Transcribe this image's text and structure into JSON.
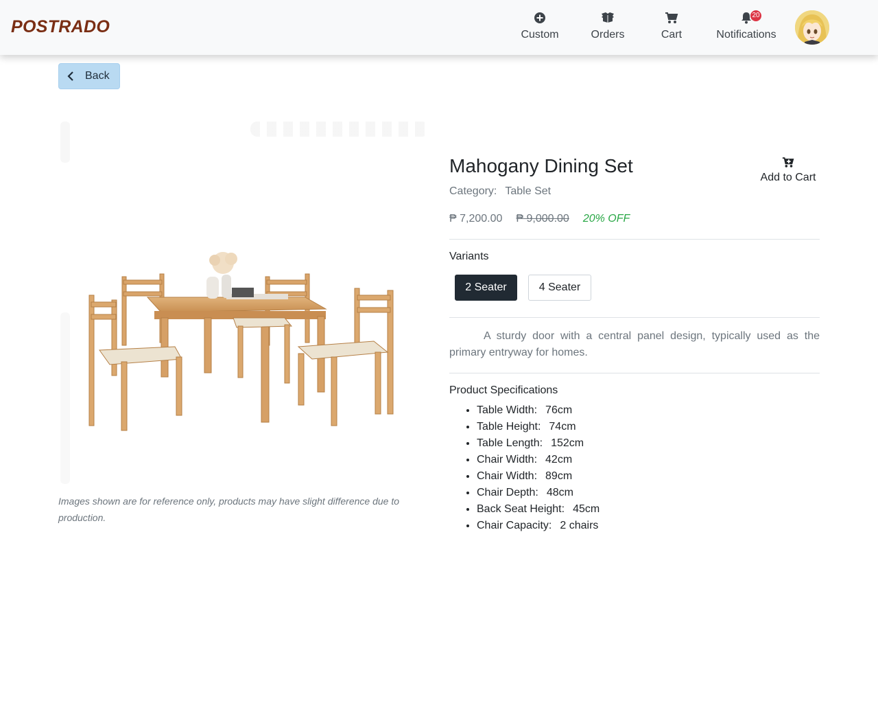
{
  "brand": "POSTRADO",
  "nav": {
    "custom": "Custom",
    "orders": "Orders",
    "cart": "Cart",
    "notifications": "Notifications",
    "notifications_badge": "20"
  },
  "back_label": "Back",
  "product": {
    "title": "Mahogany Dining Set",
    "category_label": "Category:",
    "category": "Table Set",
    "add_to_cart": "Add to Cart",
    "price": "₱ 7,200.00",
    "old_price": "₱ 9,000.00",
    "discount": "20% OFF",
    "variants_label": "Variants",
    "variants": [
      "2 Seater",
      "4 Seater"
    ],
    "selected_variant": "2 Seater",
    "description": "A sturdy door with a central panel design, typically used as the primary entryway for homes.",
    "specs_title": "Product Specifications",
    "specs": [
      {
        "label": "Table Width:",
        "value": "76cm"
      },
      {
        "label": "Table Height:",
        "value": "74cm"
      },
      {
        "label": "Table Length:",
        "value": "152cm"
      },
      {
        "label": "Chair Width:",
        "value": "42cm"
      },
      {
        "label": "Chair Width:",
        "value": "89cm"
      },
      {
        "label": "Chair Depth:",
        "value": "48cm"
      },
      {
        "label": "Back Seat Height:",
        "value": "45cm"
      },
      {
        "label": "Chair Capacity:",
        "value": "2 chairs"
      }
    ],
    "image_caption": "Images shown are for reference only, products may have slight difference due to production."
  },
  "colors": {
    "brand": "#7a2e14",
    "discount": "#28a745",
    "badge": "#dc3545",
    "active_variant": "#212a33",
    "back_button": "#b9daf2"
  },
  "icons": {
    "custom": "plus-circle-icon",
    "orders": "box-open-icon",
    "cart": "cart-icon",
    "notifications": "bell-icon",
    "add_to_cart": "cart-plus-icon",
    "back": "chevron-left-icon"
  }
}
